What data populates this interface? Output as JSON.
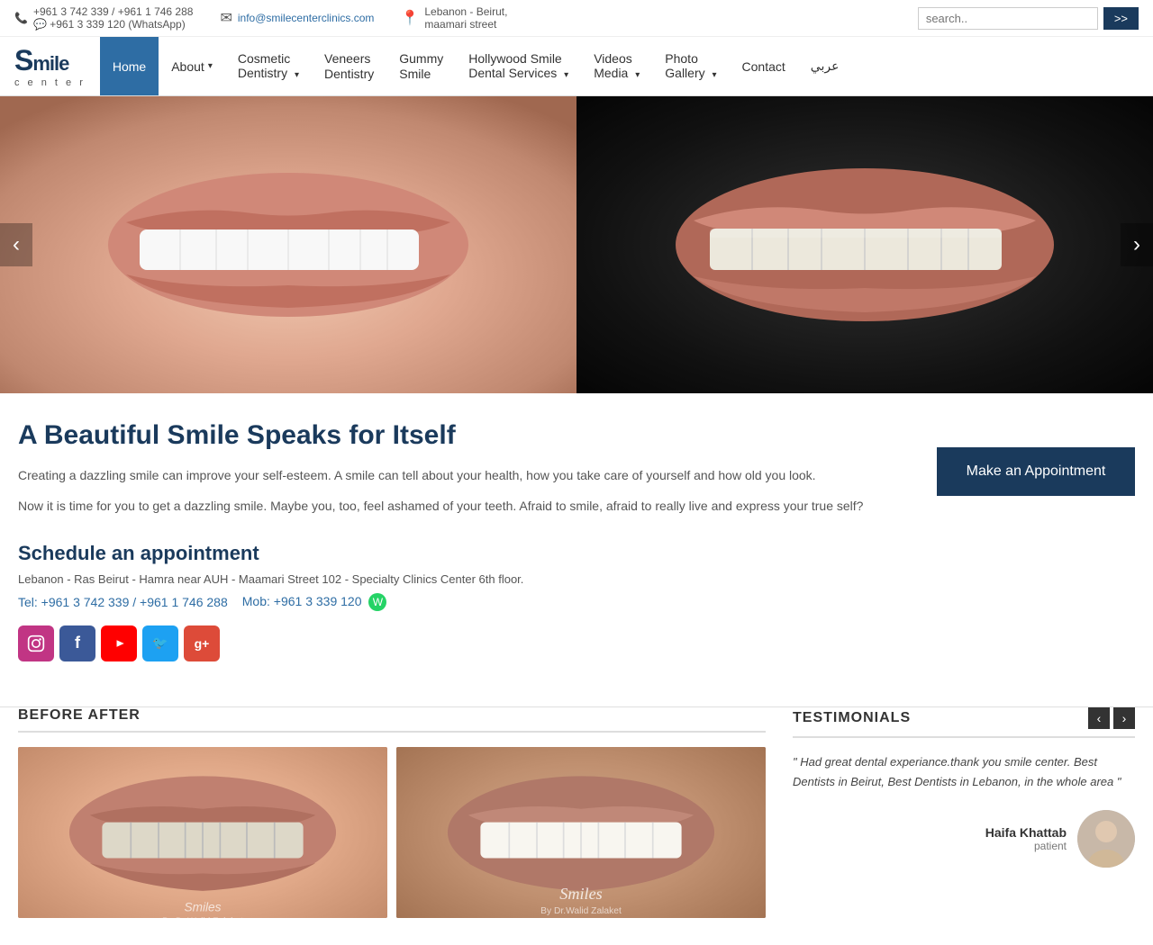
{
  "topbar": {
    "phone": "+961 3 742 339 / +961 1 746 288",
    "whatsapp": "+961 3 339 120 (WhatsApp)",
    "email": "info@smilecenterclinics.com",
    "location_line1": "Lebanon - Beirut,",
    "location_line2": "maamari street",
    "search_placeholder": "search..",
    "search_btn": ">>"
  },
  "nav": {
    "items": [
      {
        "label": "Home",
        "active": true,
        "has_dropdown": false
      },
      {
        "label": "About",
        "active": false,
        "has_dropdown": true
      },
      {
        "label": "Cosmetic\nDentistry",
        "active": false,
        "has_dropdown": true
      },
      {
        "label": "Veneers\nDentistry",
        "active": false,
        "has_dropdown": false
      },
      {
        "label": "Gummy\nSmile",
        "active": false,
        "has_dropdown": false
      },
      {
        "label": "Hollywood Smile\nDental Services",
        "active": false,
        "has_dropdown": true
      },
      {
        "label": "Videos\nMedia",
        "active": false,
        "has_dropdown": true
      },
      {
        "label": "Photo\nGallery",
        "active": false,
        "has_dropdown": true
      },
      {
        "label": "Contact",
        "active": false,
        "has_dropdown": false
      },
      {
        "label": "عربي",
        "active": false,
        "has_dropdown": false
      }
    ]
  },
  "content": {
    "title": "A Beautiful Smile Speaks for Itself",
    "para1": "Creating a dazzling smile can improve your self-esteem. A smile can tell about your health, how you take care of yourself and how old you look.",
    "para2": "Now it is time for you to get a dazzling smile. Maybe you, too, feel ashamed of your teeth. Afraid to smile, afraid to really live and express your true self?",
    "schedule_title": "Schedule an appointment",
    "address": "Lebanon - Ras Beirut - Hamra near AUH - Maamari Street 102 - Specialty Clinics Center 6th floor.",
    "tel": "Tel: +961 3 742 339 / +961 1 746 288",
    "mob": "Mob: +961 3 339 120",
    "appt_btn": "Make an Appointment"
  },
  "before_after": {
    "title": "BEFORE AFTER"
  },
  "testimonials": {
    "title": "TESTIMONIALS",
    "quote": "\" Had great dental experiance.thank you smile center. Best Dentists in Beirut, Best Dentists in Lebanon, in the whole area  \"",
    "author": "Haifa Khattab",
    "role": "patient"
  },
  "social": {
    "icons": [
      "in",
      "f",
      "yt",
      "tw",
      "g+"
    ]
  },
  "footer": {}
}
